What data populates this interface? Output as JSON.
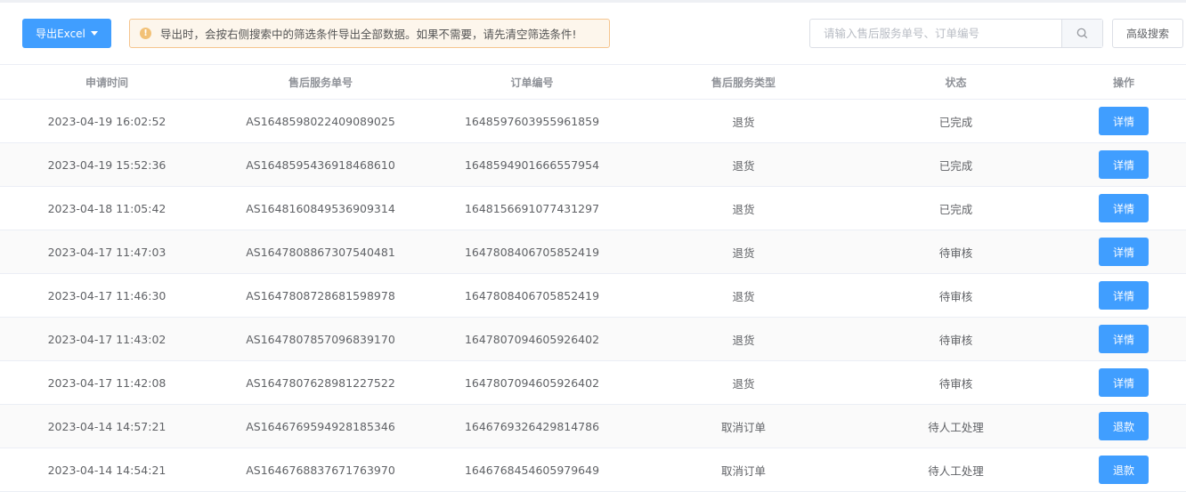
{
  "toolbar": {
    "export_label": "导出Excel",
    "alert_text": "导出时，会按右侧搜索中的筛选条件导出全部数据。如果不需要，请先清空筛选条件!",
    "search_placeholder": "请输入售后服务单号、订单编号",
    "advanced_search_label": "高级搜索"
  },
  "table": {
    "headers": [
      "申请时间",
      "售后服务单号",
      "订单编号",
      "售后服务类型",
      "状态",
      "操作"
    ],
    "rows": [
      {
        "time": "2023-04-19 16:02:52",
        "service_no": "AS1648598022409089025",
        "order_no": "1648597603955961859",
        "type": "退货",
        "status": "已完成",
        "action": "详情"
      },
      {
        "time": "2023-04-19 15:52:36",
        "service_no": "AS1648595436918468610",
        "order_no": "1648594901666557954",
        "type": "退货",
        "status": "已完成",
        "action": "详情"
      },
      {
        "time": "2023-04-18 11:05:42",
        "service_no": "AS1648160849536909314",
        "order_no": "1648156691077431297",
        "type": "退货",
        "status": "已完成",
        "action": "详情"
      },
      {
        "time": "2023-04-17 11:47:03",
        "service_no": "AS1647808867307540481",
        "order_no": "1647808406705852419",
        "type": "退货",
        "status": "待审核",
        "action": "详情"
      },
      {
        "time": "2023-04-17 11:46:30",
        "service_no": "AS1647808728681598978",
        "order_no": "1647808406705852419",
        "type": "退货",
        "status": "待审核",
        "action": "详情"
      },
      {
        "time": "2023-04-17 11:43:02",
        "service_no": "AS1647807857096839170",
        "order_no": "1647807094605926402",
        "type": "退货",
        "status": "待审核",
        "action": "详情"
      },
      {
        "time": "2023-04-17 11:42:08",
        "service_no": "AS1647807628981227522",
        "order_no": "1647807094605926402",
        "type": "退货",
        "status": "待审核",
        "action": "详情"
      },
      {
        "time": "2023-04-14 14:57:21",
        "service_no": "AS1646769594928185346",
        "order_no": "1646769326429814786",
        "type": "取消订单",
        "status": "待人工处理",
        "action": "退款"
      },
      {
        "time": "2023-04-14 14:54:21",
        "service_no": "AS1646768837671763970",
        "order_no": "1646768454605979649",
        "type": "取消订单",
        "status": "待人工处理",
        "action": "退款"
      }
    ]
  },
  "colors": {
    "primary": "#409eff",
    "alert_bg": "#fdf6ec",
    "alert_icon": "#f2c177"
  },
  "icons": {
    "alert": "warning-circle-icon",
    "search": "search-icon",
    "export_dropdown": "caret-down-icon"
  }
}
